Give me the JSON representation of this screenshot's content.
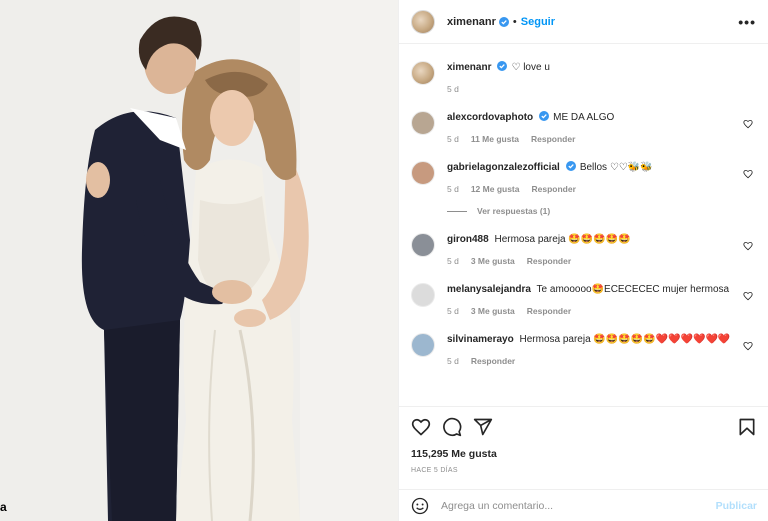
{
  "post": {
    "username": "ximenanr",
    "separator": "•",
    "follow_label": "Seguir",
    "more_label": "•••"
  },
  "caption": {
    "username": "ximenanr",
    "text": "♡ love u",
    "time": "5 d"
  },
  "comments": [
    {
      "username": "alexcordovaphoto",
      "verified": true,
      "text": "ME DA ALGO",
      "time": "5 d",
      "likes": "11 Me gusta",
      "reply_label": "Responder",
      "avatar_color": "#b8a692"
    },
    {
      "username": "gabrielagonzalezofficial",
      "verified": true,
      "text": "Bellos ♡♡🐝🐝",
      "time": "5 d",
      "likes": "12 Me gusta",
      "reply_label": "Responder",
      "view_replies": "Ver respuestas (1)",
      "avatar_color": "#c79a7f"
    },
    {
      "username": "giron488",
      "verified": false,
      "text": "Hermosa pareja 🤩🤩🤩🤩🤩",
      "time": "5 d",
      "likes": "3 Me gusta",
      "reply_label": "Responder",
      "avatar_color": "#8a8f97"
    },
    {
      "username": "melanysalejandra",
      "verified": false,
      "text": "Te amooooo🤩ECECECEC mujer hermosa",
      "time": "5 d",
      "likes": "3 Me gusta",
      "reply_label": "Responder",
      "avatar_color": "#dcdcdc"
    },
    {
      "username": "silvinamerayo",
      "verified": false,
      "text": "Hermosa pareja 🤩🤩🤩🤩🤩❤️❤️❤️❤️❤️❤️",
      "time": "5 d",
      "likes": "",
      "reply_label": "Responder",
      "avatar_color": "#9cb7cf"
    }
  ],
  "actions": {
    "like_icon": "heart-outline-icon",
    "comment_icon": "comment-bubble-icon",
    "share_icon": "paper-plane-icon",
    "save_icon": "bookmark-icon"
  },
  "likes_count": "115,295 Me gusta",
  "time_ago": "HACE 5 DÍAS",
  "comment_box": {
    "placeholder": "Agrega un comentario...",
    "publish_label": "Publicar"
  },
  "colors": {
    "accent": "#0095f6",
    "publish_disabled": "#b2dffc",
    "secondary_text": "#8e8e8e",
    "verified": "#3897f0"
  },
  "photo": {
    "edge_glyph": "a"
  }
}
